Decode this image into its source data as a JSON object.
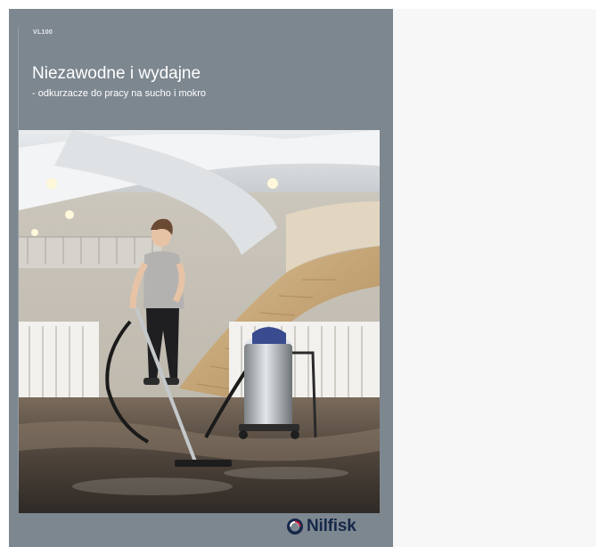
{
  "cover": {
    "model": "VL100",
    "title": "Niezawodne i wydajne",
    "subtitle": "- odkurzacze do pracy na sucho i mokro",
    "brand": "Nilfisk",
    "colors": {
      "cover_background": "#7d8790",
      "brand_navy": "#16284a",
      "page_background": "#f7f7f7"
    },
    "photo": {
      "icon": "woman-vacuuming-wet-floor-photo"
    }
  }
}
